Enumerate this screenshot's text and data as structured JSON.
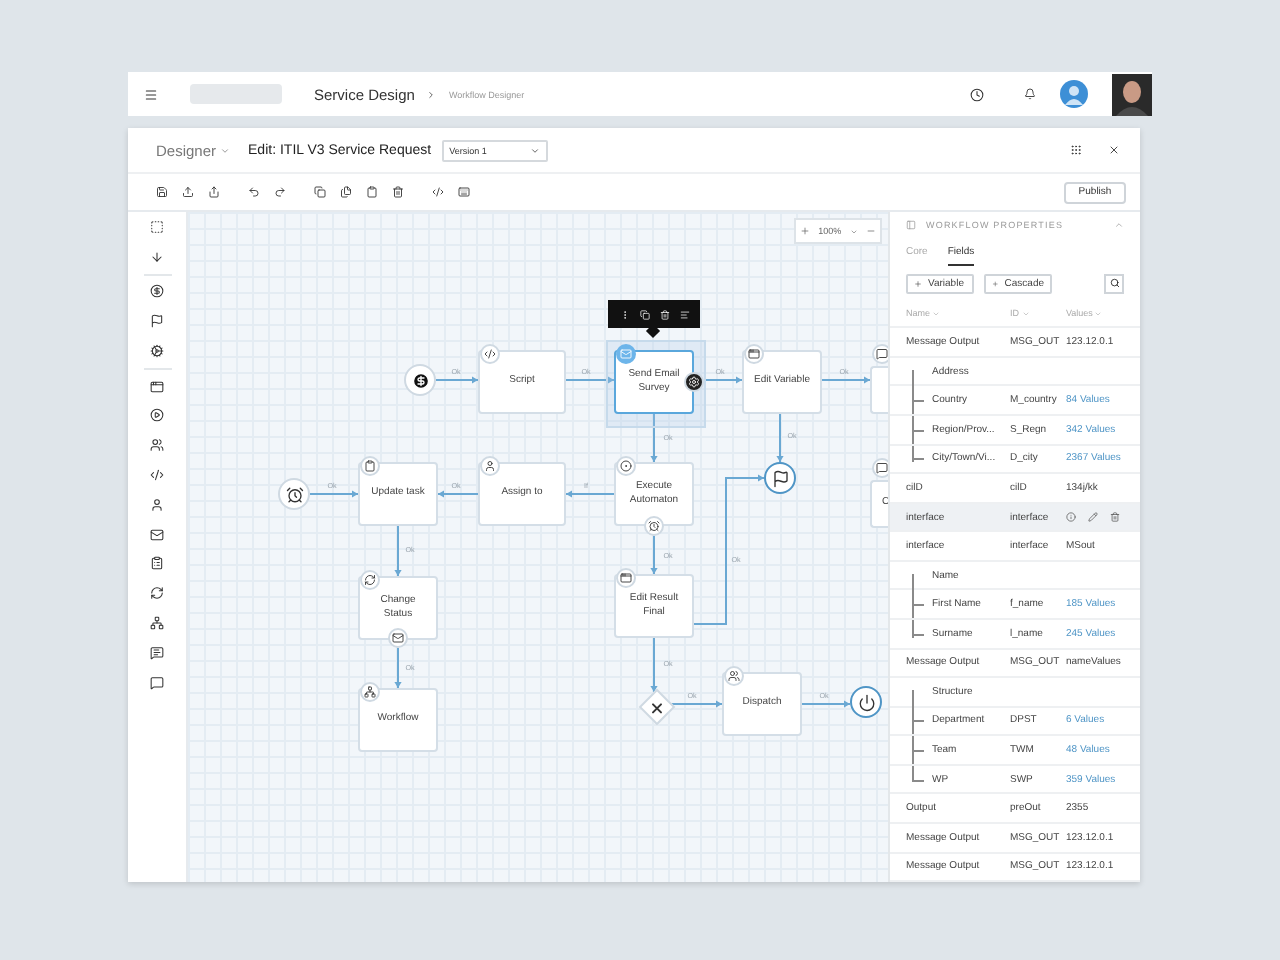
{
  "header": {
    "title": "Service Design",
    "breadcrumb": "Workflow Designer"
  },
  "editor": {
    "menu": "Designer",
    "title": "Edit: ITIL V3 Service Request",
    "version": "Version 1",
    "publish": "Publish"
  },
  "canvas": {
    "zoom": "100%",
    "nodes": [
      {
        "kind": "event"
      },
      {
        "kind": "task",
        "label": "Script",
        "selected": false
      },
      {
        "kind": "task",
        "label": "Send Email Survey",
        "selected": true
      },
      {
        "kind": "task",
        "label": "Edit Variable",
        "selected": false
      },
      {
        "kind": "task",
        "selected": false
      },
      {
        "kind": "event"
      },
      {
        "kind": "event"
      },
      {
        "kind": "task",
        "label": "Update task",
        "selected": false
      },
      {
        "kind": "task",
        "label": "Assign to",
        "selected": false
      },
      {
        "kind": "task",
        "label": "Execute Automaton",
        "selected": false
      },
      {
        "kind": "task",
        "label": "C",
        "selected": false
      },
      {
        "kind": "task",
        "label": "Change Status",
        "selected": false
      },
      {
        "kind": "task",
        "label": "Edit Result Final",
        "selected": false
      },
      {
        "kind": "task",
        "label": "Workflow",
        "selected": false
      },
      {
        "kind": "gateway"
      },
      {
        "kind": "task",
        "label": "Dispatch",
        "selected": false
      },
      {
        "kind": "event"
      }
    ],
    "edges": [
      {
        "label": "Ok"
      },
      {
        "label": "Ok"
      },
      {
        "label": "Ok"
      },
      {
        "label": "Ok"
      },
      {
        "label": "Ok"
      },
      {
        "label": "Ok"
      },
      {
        "label": "Ok"
      },
      {
        "label": "Ok"
      },
      {
        "label": "If"
      },
      {
        "label": "Ok"
      },
      {
        "label": "Ok"
      },
      {
        "label": "Ok"
      },
      {
        "label": "Ok"
      },
      {
        "label": "Ok"
      },
      {
        "label": "Ok"
      },
      {
        "label": "Ok"
      }
    ]
  },
  "properties": {
    "title": "WORKFLOW PROPERTIES",
    "tabs": [
      {
        "label": "Core",
        "selected": false
      },
      {
        "label": "Fields",
        "selected": true
      }
    ],
    "buttons": [
      "Variable",
      "Cascade"
    ],
    "columns": [
      "Name",
      "ID",
      "Values"
    ],
    "rows": [
      {
        "kind": "field",
        "name": "Message Output",
        "id": "MSG_OUT",
        "values": "123.12.0.1",
        "link": false,
        "selected": false
      },
      {
        "kind": "group",
        "name": "Address",
        "selected": false,
        "children": [
          {
            "kind": "field",
            "name": "Country",
            "id": "M_country",
            "values": "84 Values",
            "link": true,
            "selected": false
          },
          {
            "kind": "field",
            "name": "Region/Prov...",
            "id": "S_Regn",
            "values": "342 Values",
            "link": true,
            "selected": false
          },
          {
            "kind": "field",
            "name": "City/Town/Vi...",
            "id": "D_city",
            "values": "2367 Values",
            "link": true,
            "selected": false
          }
        ]
      },
      {
        "kind": "field",
        "name": "cilD",
        "id": "cilD",
        "values": "134j/kk",
        "link": false,
        "selected": false
      },
      {
        "kind": "field",
        "name": "interface",
        "id": "interface",
        "selected": true
      },
      {
        "kind": "field",
        "name": "interface",
        "id": "interface",
        "values": "MSout",
        "link": false,
        "selected": false
      },
      {
        "kind": "group",
        "name": "Name",
        "selected": false,
        "children": [
          {
            "kind": "field",
            "name": "First Name",
            "id": "f_name",
            "values": "185 Values",
            "link": true,
            "selected": false
          },
          {
            "kind": "field",
            "name": "Surname",
            "id": "l_name",
            "values": "245 Values",
            "link": true,
            "selected": false
          }
        ]
      },
      {
        "kind": "field",
        "name": "Message Output",
        "id": "MSG_OUT",
        "values": "nameValues",
        "link": false,
        "selected": false
      },
      {
        "kind": "group",
        "name": "Structure",
        "selected": false,
        "children": [
          {
            "kind": "field",
            "name": "Department",
            "id": "DPST",
            "values": "6 Values",
            "link": true,
            "selected": false
          },
          {
            "kind": "field",
            "name": "Team",
            "id": "TWM",
            "values": "48 Values",
            "link": true,
            "selected": false
          },
          {
            "kind": "field",
            "name": "WP",
            "id": "SWP",
            "values": "359 Values",
            "link": true,
            "selected": false
          }
        ]
      },
      {
        "kind": "field",
        "name": "Output",
        "id": "preOut",
        "values": "2355",
        "link": false,
        "selected": false
      },
      {
        "kind": "field",
        "name": "Message Output",
        "id": "MSG_OUT",
        "values": "123.12.0.1",
        "link": false,
        "selected": false
      },
      {
        "kind": "field",
        "name": "Message Output",
        "id": "MSG_OUT",
        "values": "123.12.0.1",
        "link": false,
        "selected": false
      }
    ]
  }
}
